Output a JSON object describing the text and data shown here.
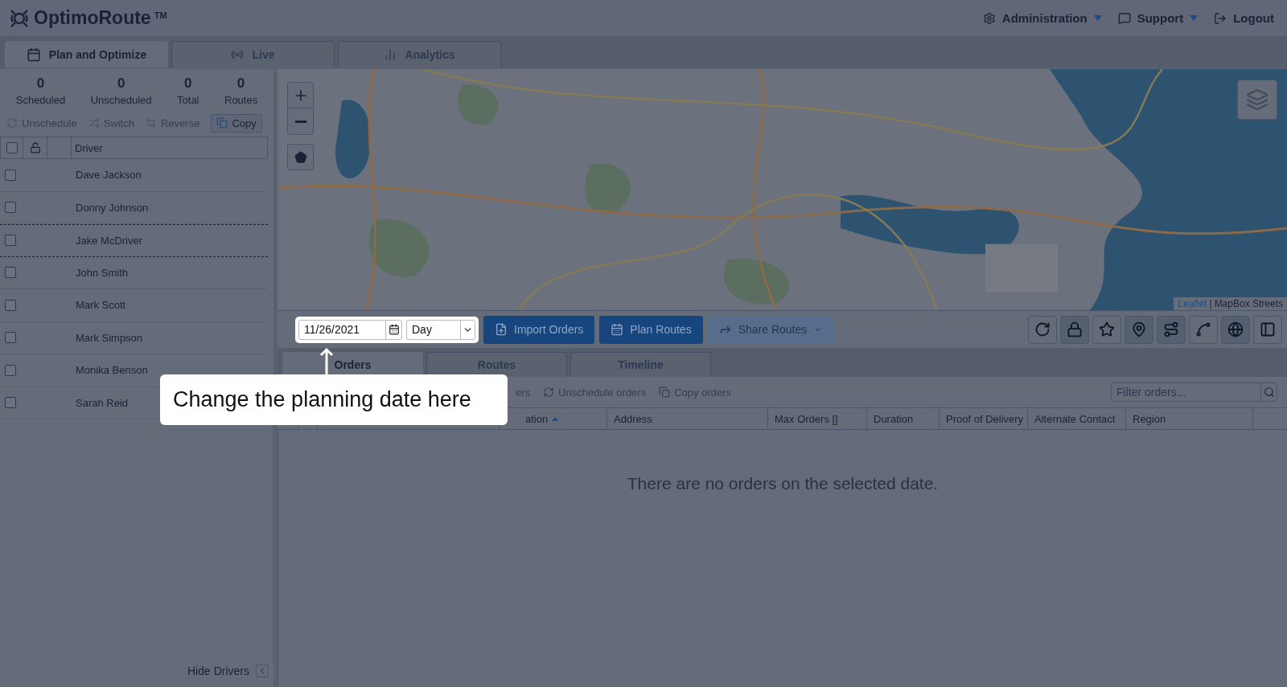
{
  "app": {
    "logo": "OptimoRoute",
    "trademark": "TM"
  },
  "nav": [
    {
      "kind": "gear",
      "label": "Administration",
      "dropdown": true
    },
    {
      "kind": "chat",
      "label": "Support",
      "dropdown": true
    },
    {
      "kind": "logout",
      "label": "Logout",
      "dropdown": false
    }
  ],
  "main_tabs": [
    {
      "kind": "calendar",
      "label": "Plan and Optimize",
      "selected": true
    },
    {
      "kind": "radio",
      "label": "Live",
      "selected": false
    },
    {
      "kind": "bars",
      "label": "Analytics",
      "selected": false
    }
  ],
  "stats": [
    {
      "value": "0",
      "label": "Scheduled"
    },
    {
      "value": "0",
      "label": "Unscheduled"
    },
    {
      "value": "0",
      "label": "Total"
    },
    {
      "value": "0",
      "label": "Routes"
    }
  ],
  "driver_actions": [
    {
      "kind": "unschedule",
      "label": "Unschedule",
      "disabled": true
    },
    {
      "kind": "switch",
      "label": "Switch",
      "disabled": true
    },
    {
      "kind": "reverse",
      "label": "Reverse",
      "disabled": true
    },
    {
      "kind": "copy",
      "label": "Copy",
      "disabled": false
    }
  ],
  "driver_table": {
    "column": "Driver",
    "select_all": {
      "checked": false
    },
    "rows": [
      {
        "name": "Dave Jackson",
        "checked": false,
        "selected": false
      },
      {
        "name": "Donny Johnson",
        "checked": false,
        "selected": false
      },
      {
        "name": "Jake McDriver",
        "checked": false,
        "selected": true
      },
      {
        "name": "John Smith",
        "checked": false,
        "selected": false
      },
      {
        "name": "Mark Scott",
        "checked": false,
        "selected": false
      },
      {
        "name": "Mark Simpson",
        "checked": false,
        "selected": false
      },
      {
        "name": "Monika Benson",
        "checked": false,
        "selected": false
      },
      {
        "name": "Sarah Reid",
        "checked": false,
        "selected": false
      }
    ]
  },
  "hide_drivers": "Hide Drivers",
  "map": {
    "kind": "picture",
    "attribution_link": "Leaflet",
    "separator": "|",
    "attribution": "MapBox Streets"
  },
  "planner": {
    "date": "11/26/2021",
    "period": "Day",
    "buttons": [
      {
        "kind": "import",
        "label": "Import Orders",
        "disabled": false
      },
      {
        "kind": "plan",
        "label": "Plan Routes",
        "disabled": false
      },
      {
        "kind": "share",
        "label": "Share Routes",
        "disabled": true
      }
    ],
    "tools": [
      {
        "kind": "refresh",
        "on": false
      },
      {
        "kind": "lock",
        "on": true
      },
      {
        "kind": "star-pin",
        "on": false
      },
      {
        "kind": "pin",
        "on": true
      },
      {
        "kind": "route",
        "on": true
      },
      {
        "kind": "spline",
        "on": false
      },
      {
        "kind": "globe",
        "on": true
      },
      {
        "kind": "panel",
        "on": false
      }
    ]
  },
  "view_tabs": [
    {
      "label": "Orders",
      "selected": true
    },
    {
      "label": "Routes",
      "selected": false
    },
    {
      "label": "Timeline",
      "selected": false
    }
  ],
  "orders_actions": [
    {
      "kind": "none",
      "label": "ers",
      "disabled": true
    },
    {
      "kind": "unschedule",
      "label": "Unschedule orders",
      "disabled": true
    },
    {
      "kind": "copy",
      "label": "Copy orders",
      "disabled": true
    }
  ],
  "filter": {
    "placeholder": "Filter orders..."
  },
  "columns": [
    {
      "label": "ation",
      "sorted": true
    },
    {
      "label": "Address",
      "sorted": false
    },
    {
      "label": "Max Orders []",
      "sorted": false
    },
    {
      "label": "Duration",
      "sorted": false
    },
    {
      "label": "Proof of Delivery",
      "sorted": false
    },
    {
      "label": "Alternate Contact",
      "sorted": false
    },
    {
      "label": "Region",
      "sorted": false
    }
  ],
  "empty_message": "There are no orders on the selected date.",
  "tooltip": {
    "text": "Change the planning date here"
  }
}
